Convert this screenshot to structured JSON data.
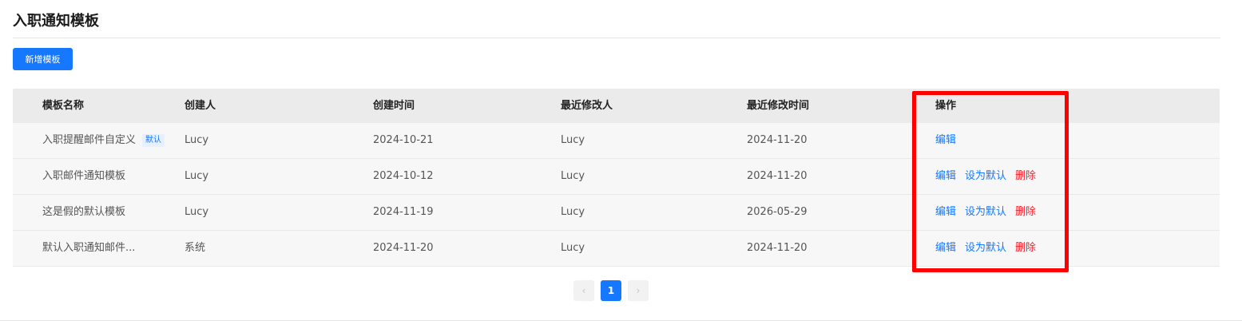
{
  "page": {
    "title": "入职通知模板"
  },
  "toolbar": {
    "add_label": "新增模板"
  },
  "table": {
    "headers": {
      "name": "模板名称",
      "creator": "创建人",
      "created_at": "创建时间",
      "modifier": "最近修改人",
      "modified_at": "最近修改时间",
      "actions": "操作"
    },
    "rows": [
      {
        "name": "入职提醒邮件自定义",
        "tag": "默认",
        "creator": "Lucy",
        "created_at": "2024-10-21",
        "modifier": "Lucy",
        "modified_at": "2024-11-20",
        "actions": [
          "编辑"
        ]
      },
      {
        "name": "入职邮件通知模板",
        "tag": "",
        "creator": "Lucy",
        "created_at": "2024-10-12",
        "modifier": "Lucy",
        "modified_at": "2024-11-20",
        "actions": [
          "编辑",
          "设为默认",
          "删除"
        ]
      },
      {
        "name": "这是假的默认模板",
        "tag": "",
        "creator": "Lucy",
        "created_at": "2024-11-19",
        "modifier": "Lucy",
        "modified_at": "2026-05-29",
        "actions": [
          "编辑",
          "设为默认",
          "删除"
        ]
      },
      {
        "name": "默认入职通知邮件...",
        "tag": "",
        "creator": "系统",
        "created_at": "2024-11-20",
        "modifier": "Lucy",
        "modified_at": "2024-11-20",
        "actions": [
          "编辑",
          "设为默认",
          "删除"
        ]
      }
    ],
    "action_colors": {
      "编辑": "#1677ff",
      "设为默认": "#1677ff",
      "删除": "#f5222d"
    }
  },
  "pagination": {
    "prev": "‹",
    "current": "1",
    "next": "›"
  },
  "highlight": {
    "color": "#ff0000"
  }
}
